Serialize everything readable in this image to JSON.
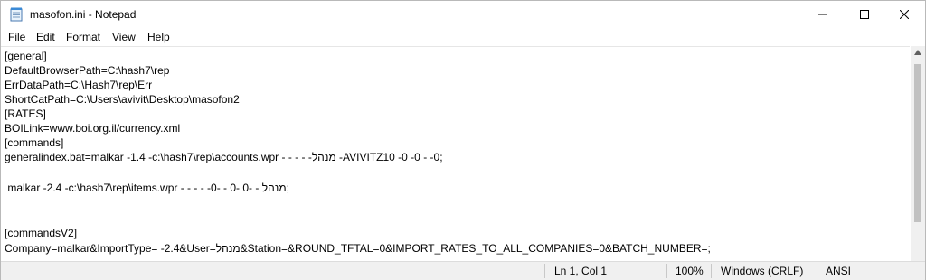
{
  "window": {
    "title": "masofon.ini - Notepad"
  },
  "menu": {
    "items": [
      "File",
      "Edit",
      "Format",
      "View",
      "Help"
    ]
  },
  "editor": {
    "lines": [
      "[general]",
      "DefaultBrowserPath=C:\\hash7\\rep",
      "ErrDataPath=C:\\Hash7\\rep\\Err",
      "ShortCatPath=C:\\Users\\avivit\\Desktop\\masofon2",
      "[RATES]",
      "BOILink=www.boi.org.il/currency.xml",
      "[commands]",
      "generalindex.bat=malkar -1.4 -c:\\hash7\\rep\\accounts.wpr - - - - -מנהל -AVIVITZ10 -0 -0 - -0;",
      "",
      " malkar -2.4 -c:\\hash7\\rep\\items.wpr - - - - -0- - 0- 0- - מנהל;",
      "",
      "",
      "[commandsV2]",
      "Company=malkar&ImportType= -2.4&User=מנהל&Station=&ROUND_TFTAL=0&IMPORT_RATES_TO_ALL_COMPANIES=0&BATCH_NUMBER=;"
    ]
  },
  "status": {
    "position": "Ln 1, Col 1",
    "zoom": "100%",
    "line_ending": "Windows (CRLF)",
    "encoding": "ANSI"
  },
  "icons": {
    "app": "notepad-icon",
    "minimize": "minimize-icon",
    "maximize": "maximize-icon",
    "close": "close-icon"
  }
}
